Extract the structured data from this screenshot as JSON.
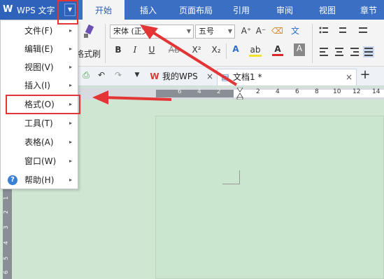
{
  "app": {
    "logo": "W",
    "title": "WPS 文字",
    "dropdown": "▼"
  },
  "tabs": [
    {
      "label": "开始"
    },
    {
      "label": "插入"
    },
    {
      "label": "页面布局"
    },
    {
      "label": "引用"
    },
    {
      "label": "审阅"
    },
    {
      "label": "视图"
    },
    {
      "label": "章节"
    }
  ],
  "ribbon": {
    "format_painter": "格式刷",
    "font_name": "宋体 (正文)",
    "font_size": "五号",
    "grow": "A⁺",
    "shrink": "A⁻",
    "clear": "⌫",
    "wen": "文",
    "bold": "B",
    "italic": "I",
    "underline": "U",
    "strike": "AB",
    "superscript": "X²",
    "subscript": "X₂",
    "font_color": "A",
    "highlight": "ab",
    "char_shading": "A"
  },
  "doc_tabs": [
    {
      "label": "我的WPS",
      "close": "×"
    },
    {
      "label": "文档1 *",
      "close": "×"
    }
  ],
  "new_tab": "+",
  "ruler": {
    "ticks_left": [
      "6",
      "4",
      "2"
    ],
    "ticks_right": [
      "2",
      "4",
      "6",
      "8",
      "10",
      "12",
      "14"
    ]
  },
  "vruler": [
    "1",
    "2",
    "3",
    "4",
    "5",
    "6"
  ],
  "menu": {
    "items": [
      {
        "label": "文件(F)"
      },
      {
        "label": "编辑(E)"
      },
      {
        "label": "视图(V)"
      },
      {
        "label": "插入(I)"
      },
      {
        "label": "格式(O)"
      },
      {
        "label": "工具(T)"
      },
      {
        "label": "表格(A)"
      },
      {
        "label": "窗口(W)"
      },
      {
        "label": "帮助(H)"
      }
    ],
    "submenu_glyph": "▸",
    "help_icon": "?"
  },
  "colors": {
    "titlebar": "#3a6fc4",
    "annotation": "#e33535",
    "page": "#cbe6cf"
  }
}
